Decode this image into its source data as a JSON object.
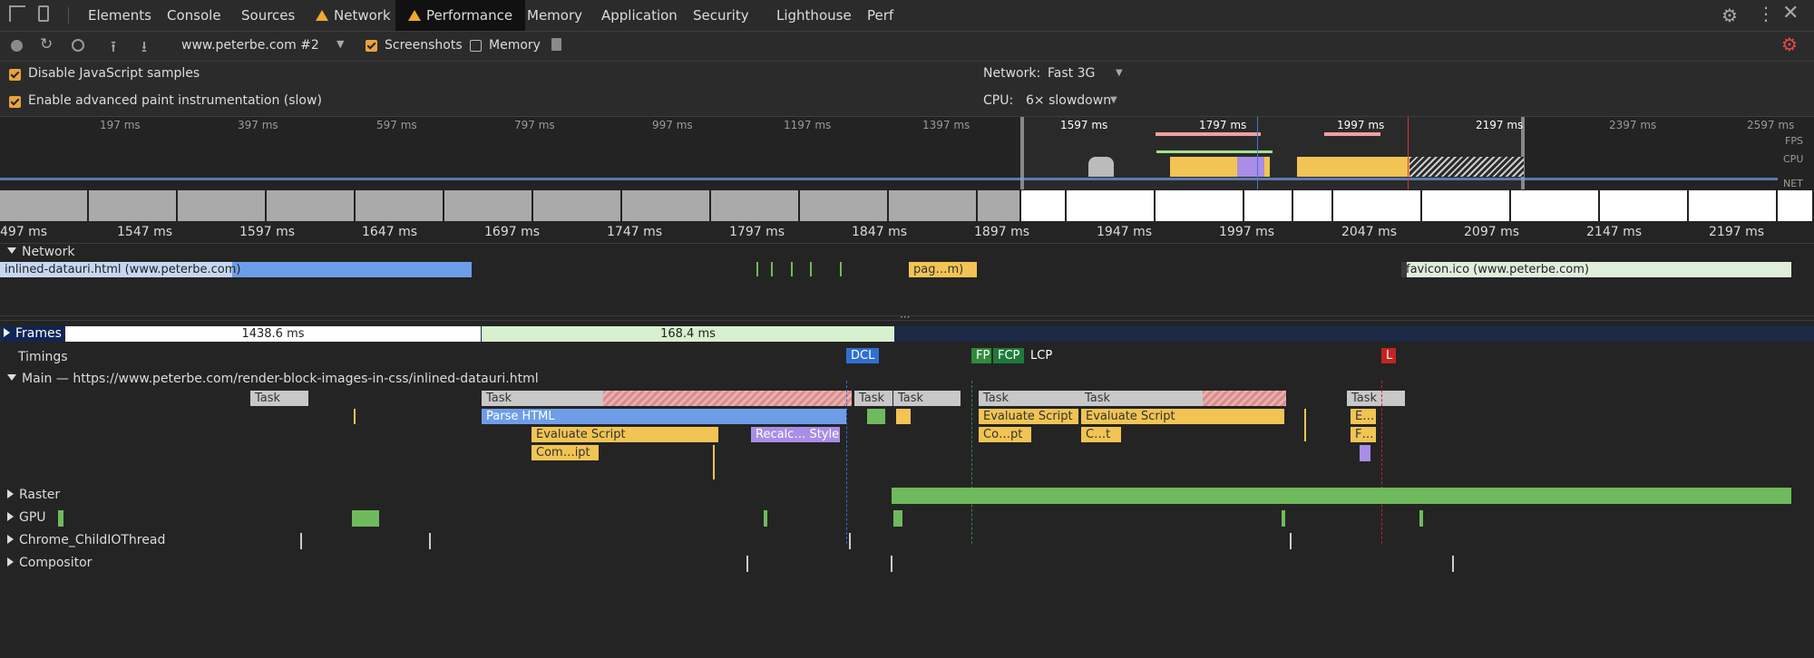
{
  "tabs": [
    "Elements",
    "Console",
    "Sources",
    "Network",
    "Performance",
    "Memory",
    "Application",
    "Security",
    "Lighthouse",
    "Perf"
  ],
  "toolbar": {
    "profile_select": "www.peterbe.com #2",
    "screenshots_label": "Screenshots",
    "memory_label": "Memory",
    "screenshots_checked": true,
    "memory_checked": false
  },
  "settings": {
    "disable_js_samples": "Disable JavaScript samples",
    "advanced_paint": "Enable advanced paint instrumentation (slow)",
    "network_label": "Network:",
    "network_value": "Fast 3G",
    "cpu_label": "CPU:",
    "cpu_value": "6× slowdown"
  },
  "overview_ticks": [
    "197 ms",
    "397 ms",
    "597 ms",
    "797 ms",
    "997 ms",
    "1197 ms",
    "1397 ms",
    "1597 ms",
    "1797 ms",
    "1997 ms",
    "2197 ms",
    "2397 ms",
    "2597 ms"
  ],
  "overview_tracks": [
    "FPS",
    "CPU",
    "NET"
  ],
  "timeline_ticks": [
    "497 ms",
    "1547 ms",
    "1597 ms",
    "1647 ms",
    "1697 ms",
    "1747 ms",
    "1797 ms",
    "1847 ms",
    "1897 ms",
    "1947 ms",
    "1997 ms",
    "2047 ms",
    "2097 ms",
    "2147 ms",
    "2197 ms"
  ],
  "network": {
    "section": "Network",
    "req1": "inlined-datauri.html (www.peterbe.com)",
    "req2": "pag…m)",
    "req3": "favicon.ico (www.peterbe.com)"
  },
  "frames": {
    "label": "Frames",
    "f1": "1438.6 ms",
    "f2": "168.4 ms"
  },
  "timings": {
    "label": "Timings",
    "dcl": "DCL",
    "fp": "FP",
    "fcp": "FCP",
    "lcp": "LCP",
    "l": "L"
  },
  "main": {
    "label": "Main — https://www.peterbe.com/render-block-images-in-css/inlined-datauri.html",
    "task": "Task",
    "parse_html": "Parse HTML",
    "evaluate_script": "Evaluate Script",
    "recalc_style": "Recalc… Style",
    "compile_script": "Com…ipt",
    "copt": "Co…pt",
    "ct": "C…t",
    "e": "E…",
    "f": "F…"
  },
  "threads": [
    "Raster",
    "GPU",
    "Chrome_ChildIOThread",
    "Compositor"
  ],
  "colors": {
    "accent": "#e8a33d",
    "warning": "#f0a830",
    "record_red": "#e24a4a"
  }
}
